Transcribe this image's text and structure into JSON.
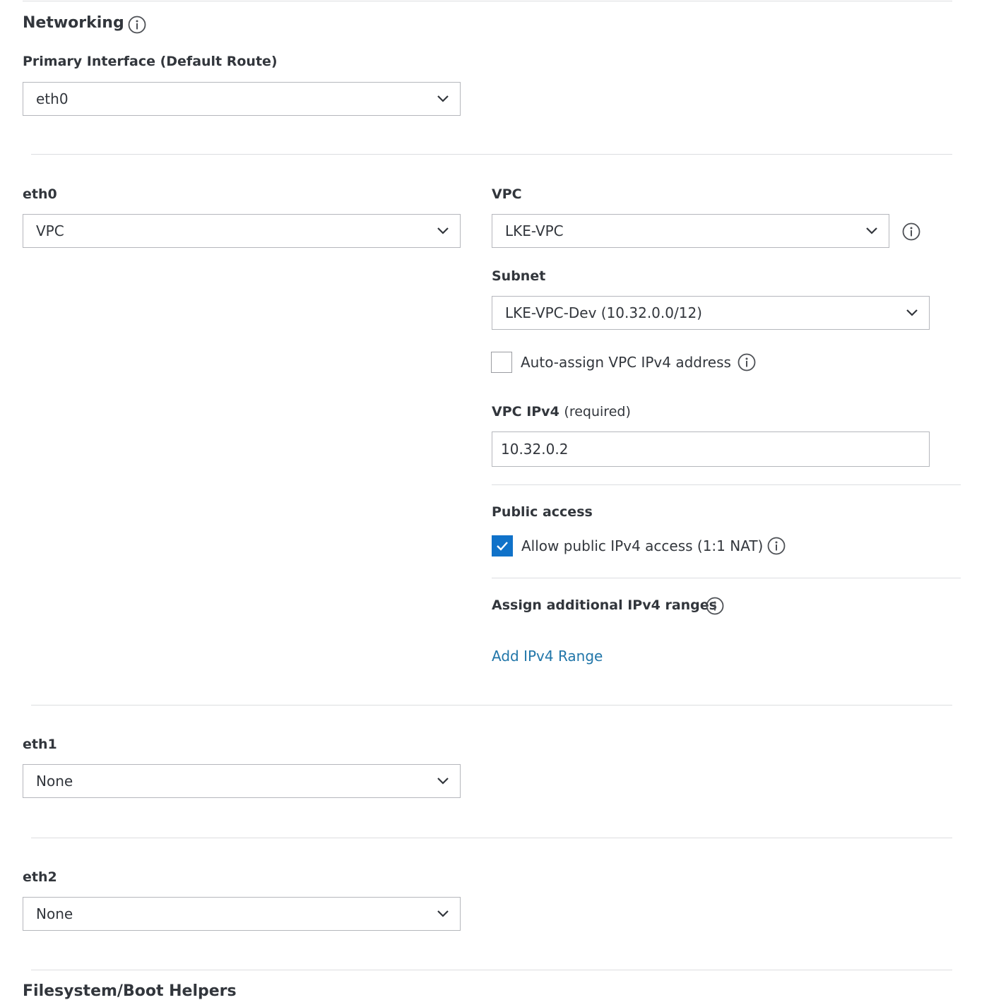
{
  "networking": {
    "title": "Networking",
    "primary_interface": {
      "label": "Primary Interface (Default Route)",
      "value": "eth0"
    }
  },
  "eth0": {
    "label": "eth0",
    "value": "VPC",
    "vpc": {
      "label": "VPC",
      "value": "LKE-VPC"
    },
    "subnet": {
      "label": "Subnet",
      "value": "LKE-VPC-Dev (10.32.0.0/12)"
    },
    "auto_assign": {
      "label": "Auto-assign VPC IPv4 address",
      "checked": false
    },
    "vpc_ipv4": {
      "label": "VPC IPv4",
      "required_text": "(required)",
      "value": "10.32.0.2"
    },
    "public_access": {
      "label": "Public access",
      "checkbox_label": "Allow public IPv4 access (1:1 NAT)",
      "checked": true
    },
    "additional_ranges": {
      "label": "Assign additional IPv4 ranges",
      "link": "Add IPv4 Range"
    }
  },
  "eth1": {
    "label": "eth1",
    "value": "None"
  },
  "eth2": {
    "label": "eth2",
    "value": "None"
  },
  "next_section": {
    "title": "Filesystem/Boot Helpers"
  },
  "colors": {
    "accent": "#1072c9",
    "link": "#2176a9",
    "border": "#b5b7bc",
    "divider": "#dcdde0",
    "text": "#32363c"
  }
}
